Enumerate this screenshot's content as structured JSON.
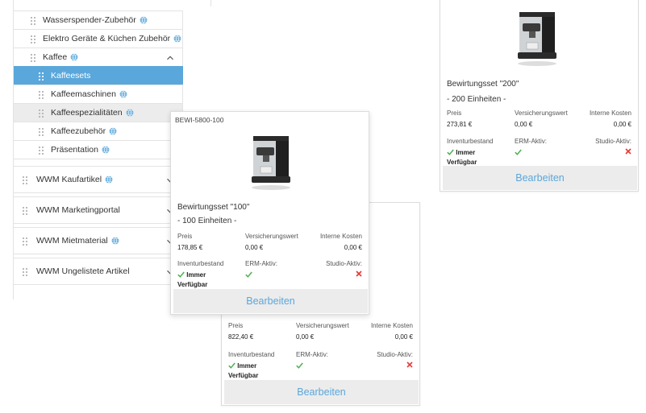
{
  "sidebar": {
    "items": [
      {
        "label": "Wasserspender-Zubehör",
        "globe": true
      },
      {
        "label": "Elektro Geräte & Küchen Zubehör",
        "globe": true
      },
      {
        "label": "Kaffee",
        "globe": true,
        "expanded": true
      },
      {
        "label": "Kaffeesets",
        "globe": false,
        "active": true
      },
      {
        "label": "Kaffeemaschinen",
        "globe": true
      },
      {
        "label": "Kaffeespezialitäten",
        "globe": true,
        "hover": true
      },
      {
        "label": "Kaffeezubehör",
        "globe": true
      },
      {
        "label": "Präsentation",
        "globe": true
      }
    ],
    "groups": [
      {
        "label": "WWM Kaufartikel",
        "globe": true
      },
      {
        "label": "WWM Marketingportal",
        "globe": false
      },
      {
        "label": "WWM Mietmaterial",
        "globe": true
      },
      {
        "label": "WWM Ungelistete Artikel",
        "globe": false
      }
    ]
  },
  "labels": {
    "preis": "Preis",
    "versicherungswert": "Versicherungswert",
    "interne_kosten": "Interne Kosten",
    "inventurbestand": "Inventurbestand",
    "erm_aktiv": "ERM-Aktiv:",
    "studio_aktiv": "Studio-Aktiv:",
    "immer": "Immer",
    "verfuegbar": "Verfügbar",
    "bearbeiten": "Bearbeiten"
  },
  "cards": {
    "c200": {
      "title": "Bewirtungsset \"200\"",
      "units": "- 200 Einheiten -",
      "preis": "273,81 €",
      "versicherungswert": "0,00 €",
      "interne_kosten": "0,00 €"
    },
    "c100": {
      "sku": "BEWI-5800-100",
      "title": "Bewirtungsset \"100\"",
      "units": "- 100 Einheiten -",
      "preis": "178,85 €",
      "versicherungswert": "0,00 €",
      "interne_kosten": "0,00 €"
    },
    "cbottom": {
      "preis": "822,40 €",
      "versicherungswert": "0,00 €",
      "interne_kosten": "0,00 €"
    }
  },
  "colors": {
    "accent": "#5aa7db",
    "check": "#4caf50",
    "cross": "#e53935"
  },
  "icons": [
    "grip-icon",
    "globe-icon",
    "chevron-up-icon",
    "chevron-down-icon",
    "check-icon",
    "cross-icon",
    "coffee-machine-image"
  ]
}
